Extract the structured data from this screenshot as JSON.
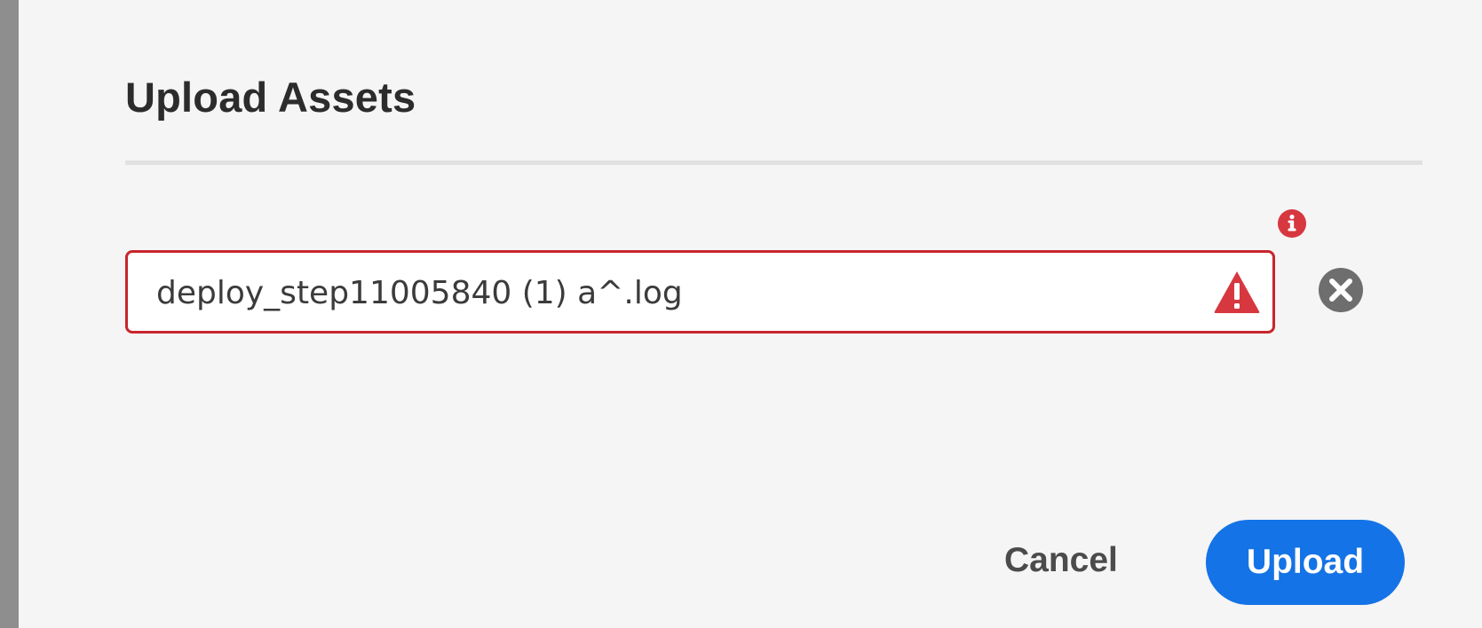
{
  "dialog": {
    "title": "Upload Assets",
    "file": {
      "name": "deploy_step11005840 (1) a^.log",
      "status": "error"
    },
    "buttons": {
      "cancel_label": "Cancel",
      "upload_label": "Upload"
    }
  },
  "colors": {
    "accent": "#1473e6",
    "error": "#c9252d",
    "alert_fill": "#d7373f",
    "info_fill": "#d7373f",
    "remove_fill": "#6e6e6e"
  },
  "icons": {
    "info": "info-icon",
    "alert": "alert-icon",
    "remove": "close-circle-icon"
  }
}
